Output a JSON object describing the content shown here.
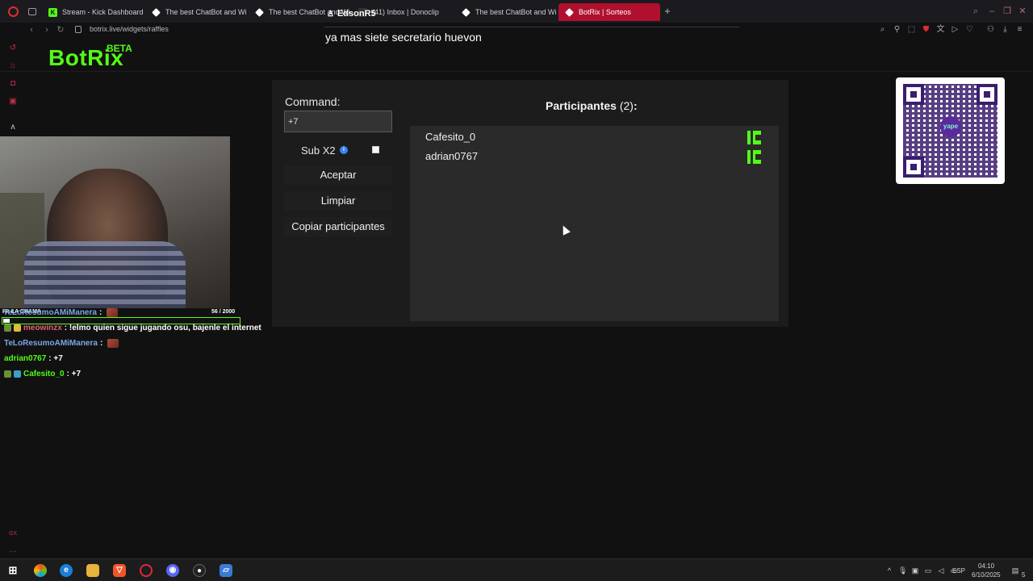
{
  "browser": {
    "tabs": [
      {
        "label": "Stream - Kick Dashboard",
        "active": false
      },
      {
        "label": "The best ChatBot and Wi",
        "active": false
      },
      {
        "label": "The best ChatBot and Wi",
        "active": false
      },
      {
        "label": "(41) Inbox | Donoclip",
        "active": false
      },
      {
        "label": "The best ChatBot and Wi",
        "active": false
      },
      {
        "label": "BotRix | Sorteos",
        "active": true
      }
    ],
    "url": "botrix.live/widgets/raffles",
    "accent": "#b0102e"
  },
  "overlay": {
    "username": "EdsonR5",
    "message": "ya mas siete secretario huevon"
  },
  "logo": {
    "name": "BotRix",
    "badge": "BETA",
    "color": "#53fc18"
  },
  "raffle": {
    "command_label": "Command:",
    "command_value": "+7",
    "sub_label": "Sub X2",
    "accept_label": "Aceptar",
    "clear_label": "Limpiar",
    "copy_label": "Copiar participantes",
    "participants_title": "Participantes",
    "participants_count": "(2)",
    "participants_suffix": ":",
    "participants": [
      {
        "name": "Cafesito_0",
        "platform": "kick"
      },
      {
        "name": "adrian0767",
        "platform": "kick"
      }
    ]
  },
  "stream_overlay": {
    "goal_label": "PA LA CHAMA",
    "goal_count": "56  / 2000",
    "goal_progress": 0.028,
    "chat": [
      {
        "user": "TeLoResumoAMiManera",
        "text": ":",
        "user_color": "#7aa7e6",
        "emote": true
      },
      {
        "user": "meowinzx",
        "text": ": !elmo quien sigue jugando osu, bajenle el internet",
        "user_color": "#e85d75",
        "emote": false
      },
      {
        "user": "TeLoResumoAMiManera",
        "text": ":",
        "user_color": "#7aa7e6",
        "emote": true
      },
      {
        "user": "adrian0767",
        "text": ": +7",
        "user_color": "#53fc18",
        "emote": false
      },
      {
        "user": "Cafesito_0",
        "text": ": +7",
        "user_color": "#53fc18",
        "emote": false
      }
    ]
  },
  "taskbar": {
    "language": "ESP",
    "time": "04:10",
    "date": "6/10/2025",
    "notifications": "5"
  }
}
